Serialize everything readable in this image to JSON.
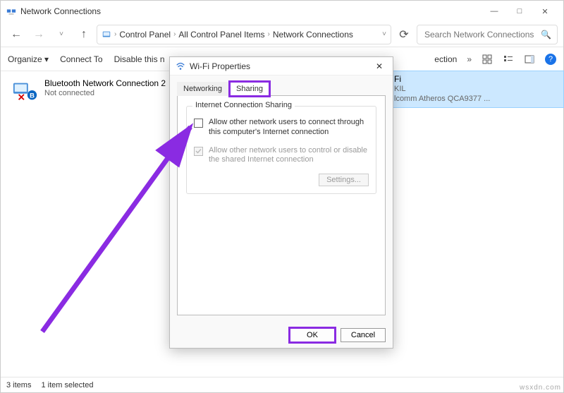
{
  "window": {
    "title": "Network Connections",
    "min": "—",
    "max": "□",
    "close": "✕"
  },
  "nav": {
    "back": "←",
    "fwd": "→",
    "up": "↑",
    "refresh": "⟳",
    "dropdown": "˅"
  },
  "breadcrumb": {
    "root": "Control Panel",
    "mid": "All Control Panel Items",
    "leaf": "Network Connections"
  },
  "search": {
    "placeholder": "Search Network Connections",
    "icon": "🔍"
  },
  "toolbar": {
    "organize": "Organize ▾",
    "connect": "Connect To",
    "disable": "Disable this n",
    "ection_tail": "ection",
    "chev": "»"
  },
  "connections": {
    "left": {
      "title": "Bluetooth Network Connection 2",
      "status": "Not connected"
    },
    "right": {
      "title": "Fi",
      "line2": "KIL",
      "line3": "lcomm Atheros QCA9377 ..."
    }
  },
  "statusbar": {
    "count": "3 items",
    "selection": "1 item selected"
  },
  "dialog": {
    "title": "Wi-Fi Properties",
    "tabs": {
      "networking": "Networking",
      "sharing": "Sharing"
    },
    "group_title": "Internet Connection Sharing",
    "opt_allow_connect": "Allow other network users to connect through this computer's Internet connection",
    "opt_allow_control": "Allow other network users to control or disable the shared Internet connection",
    "settings_btn": "Settings...",
    "ok": "OK",
    "cancel": "Cancel",
    "close_x": "✕"
  },
  "watermark": "wsxdn.com"
}
